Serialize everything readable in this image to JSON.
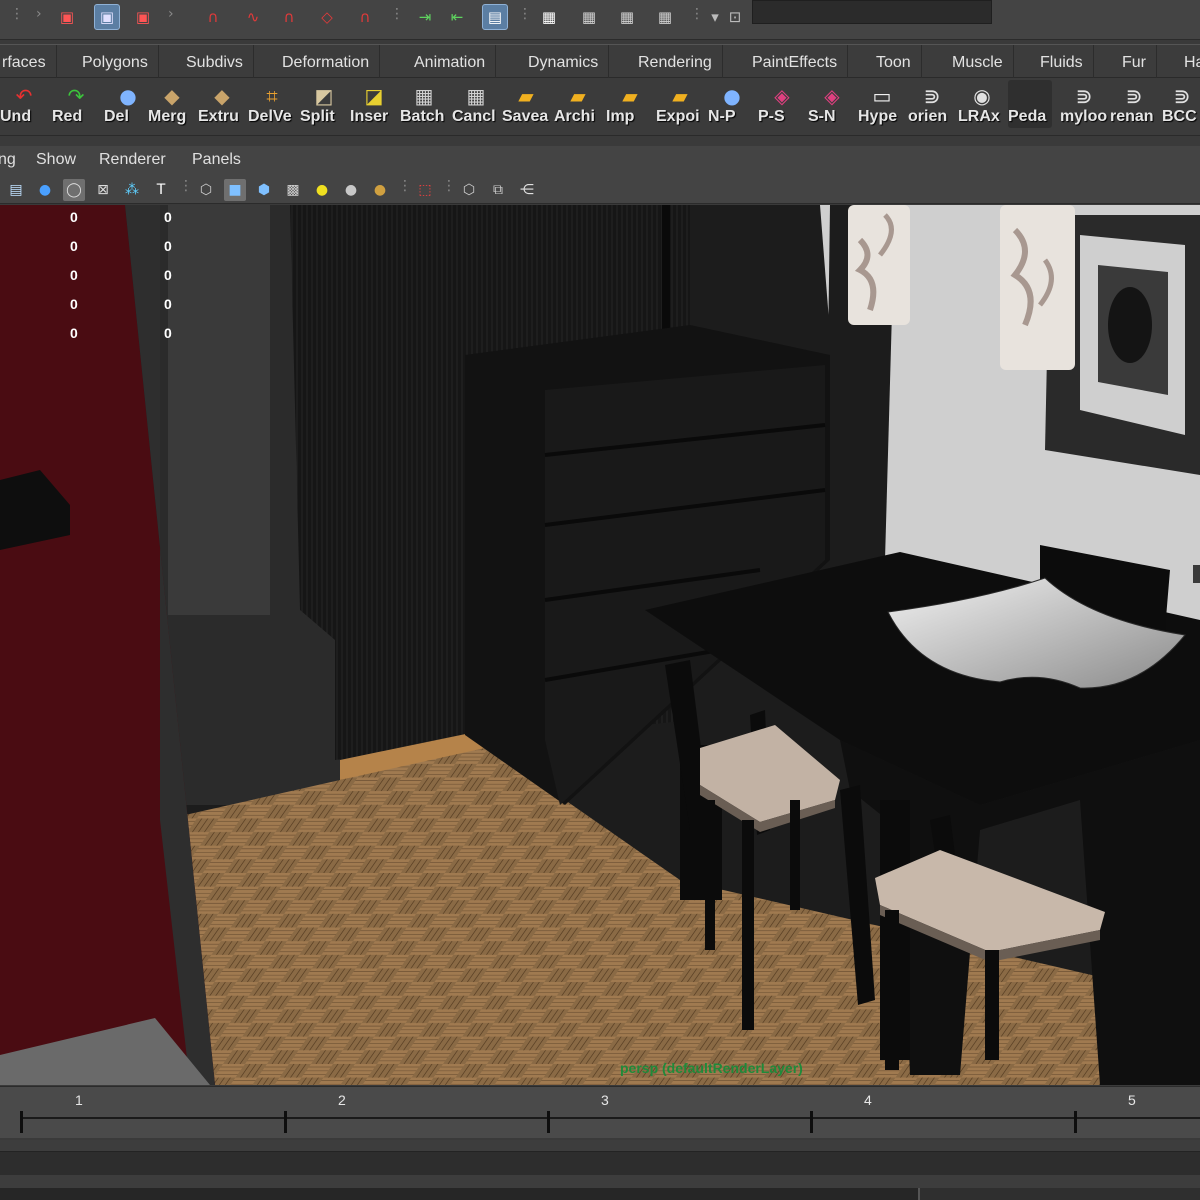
{
  "status_line": {
    "icons": [
      "select-by-hierarchy-icon",
      "select-by-object-type-icon",
      "select-by-component-type-icon",
      "snap-to-grids-icon",
      "snap-to-curves-icon",
      "snap-to-points-icon",
      "snap-to-view-planes-icon",
      "make-live-icon",
      "input-output-icon",
      "construction-history-icon",
      "render-view-icon",
      "render-current-frame-icon",
      "ipr-render-icon",
      "render-settings-icon",
      "hypershade-icon"
    ]
  },
  "shelf_tabs": [
    "rfaces",
    "Polygons",
    "Subdivs",
    "Deformation",
    "Animation",
    "Dynamics",
    "Rendering",
    "PaintEffects",
    "Toon",
    "Muscle",
    "Fluids",
    "Fur",
    "Ha"
  ],
  "shelf_buttons": [
    {
      "label": "Und",
      "icon": "undo-icon"
    },
    {
      "label": "Red",
      "icon": "redo-icon"
    },
    {
      "label": "Del",
      "icon": "delete-history-icon"
    },
    {
      "label": "Merg",
      "icon": "merge-icon"
    },
    {
      "label": "Extru",
      "icon": "extrude-icon"
    },
    {
      "label": "DelVe",
      "icon": "delete-vertex-icon"
    },
    {
      "label": "Split",
      "icon": "split-polygon-icon"
    },
    {
      "label": "Inser",
      "icon": "insert-edge-loop-icon"
    },
    {
      "label": "Batch",
      "icon": "batch-render-icon"
    },
    {
      "label": "Cancl",
      "icon": "cancel-batch-icon"
    },
    {
      "label": "Savea",
      "icon": "save-as-folder-icon"
    },
    {
      "label": "Archi",
      "icon": "archive-folder-icon"
    },
    {
      "label": "Imp",
      "icon": "import-folder-icon"
    },
    {
      "label": "Expoi",
      "icon": "export-folder-icon"
    },
    {
      "label": "N-P",
      "icon": "nurbs-to-poly-icon"
    },
    {
      "label": "P-S",
      "icon": "poly-to-subdiv-icon"
    },
    {
      "label": "S-N",
      "icon": "subdiv-to-nurbs-icon"
    },
    {
      "label": "Hype",
      "icon": "hypergraph-icon"
    },
    {
      "label": "orien",
      "icon": "orient-icon"
    },
    {
      "label": "LRAx",
      "icon": "local-rotation-axes-icon"
    },
    {
      "label": "Peda",
      "icon": "blank-shelf-icon"
    },
    {
      "label": "myloo",
      "icon": "script-icon"
    },
    {
      "label": "renan",
      "icon": "rename-script-icon"
    },
    {
      "label": "BCC",
      "icon": "bcc-script-icon"
    }
  ],
  "panel_menu": [
    "ng",
    "Show",
    "Renderer",
    "Panels"
  ],
  "panel_toolbar": {
    "icons": [
      "film-gate-icon",
      "smooth-shade-icon",
      "wireframe-on-shaded-icon",
      "xray-icon",
      "uv-icon",
      "texture-icon",
      "wireframe-cube-icon",
      "shaded-cube-icon",
      "textured-cube-icon",
      "checker-icon",
      "default-light-icon",
      "shadow-sphere-icon",
      "lit-sphere-icon",
      "select-camera-icon",
      "isolate-select-icon",
      "grid-icon",
      "share-icon"
    ]
  },
  "viewport": {
    "hud_left": [
      "0",
      "0",
      "0",
      "0",
      "0"
    ],
    "hud_right": [
      "0",
      "0",
      "0",
      "0",
      "0"
    ],
    "camera_label": "persp (defaultRenderLayer)"
  },
  "time_slider": {
    "ticks": [
      "1",
      "2",
      "3",
      "4",
      "5"
    ]
  }
}
